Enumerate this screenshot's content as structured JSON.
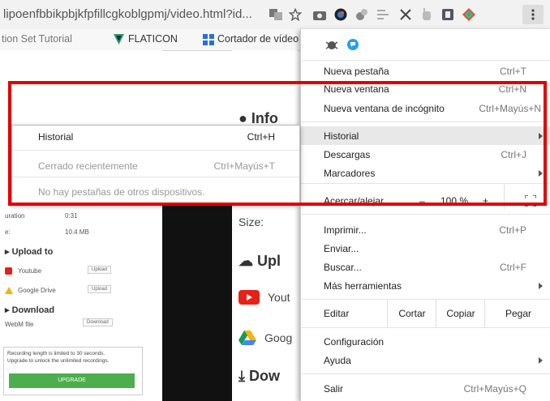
{
  "urlbar": {
    "url": "lipoenfbbikpbjkfpfillcgkoblgpmj/video.html?id..."
  },
  "bookmarks": {
    "items": [
      "tion Set Tutorial",
      "FLATICON",
      "Cortador de vídeo on"
    ]
  },
  "page_left": {
    "duration_label": "uration",
    "duration_value": "0:31",
    "size_label": "e:",
    "size_value": "10.4 MB",
    "upload_title": "Upload to",
    "youtube": "Youtube",
    "youtube_btn": "Upload",
    "gdrive": "Google Drive",
    "gdrive_btn": "Upload",
    "download_title": "Download",
    "webm": "WebM file",
    "download_btn": "Download",
    "notice_line1": "Recording length is limited to 30 seconds.",
    "notice_line2": "Upgrade to unlock the unlimited recordings.",
    "upgrade_btn": "UPGRADE"
  },
  "page_right": {
    "info": "Info",
    "size": "Size:",
    "upload": "Upl",
    "youtube": "Yout",
    "google": "Goog",
    "download": "Dow"
  },
  "menu": {
    "new_tab": "Nueva pestaña",
    "new_tab_key": "Ctrl+T",
    "new_window": "Nueva ventana",
    "new_window_key": "Ctrl+N",
    "incognito": "Nueva ventana de incógnito",
    "incognito_key": "Ctrl+Mayús+N",
    "history": "Historial",
    "downloads": "Descargas",
    "downloads_key": "Ctrl+J",
    "bookmarks": "Marcadores",
    "zoom": "Acercar/alejar",
    "zoom_minus": "–",
    "zoom_value": "100 %",
    "zoom_plus": "+",
    "print": "Imprimir...",
    "print_key": "Ctrl+P",
    "send": "Enviar...",
    "find": "Buscar...",
    "find_key": "Ctrl+F",
    "more_tools": "Más herramientas",
    "edit": "Editar",
    "cut": "Cortar",
    "copy": "Copiar",
    "paste": "Pegar",
    "settings": "Configuración",
    "help": "Ayuda",
    "exit": "Salir",
    "exit_key": "Ctrl+Mayús+Q"
  },
  "history_submenu": {
    "history": "Historial",
    "history_key": "Ctrl+H",
    "recent": "Cerrado recientemente",
    "recent_key": "Ctrl+Mayús+T",
    "no_tabs": "No hay pestañas de otros dispositivos."
  },
  "colors": {
    "annotation_red": "#e10000",
    "menu_highlight": "#e8e8e8",
    "accent_green": "#4cae4c"
  }
}
